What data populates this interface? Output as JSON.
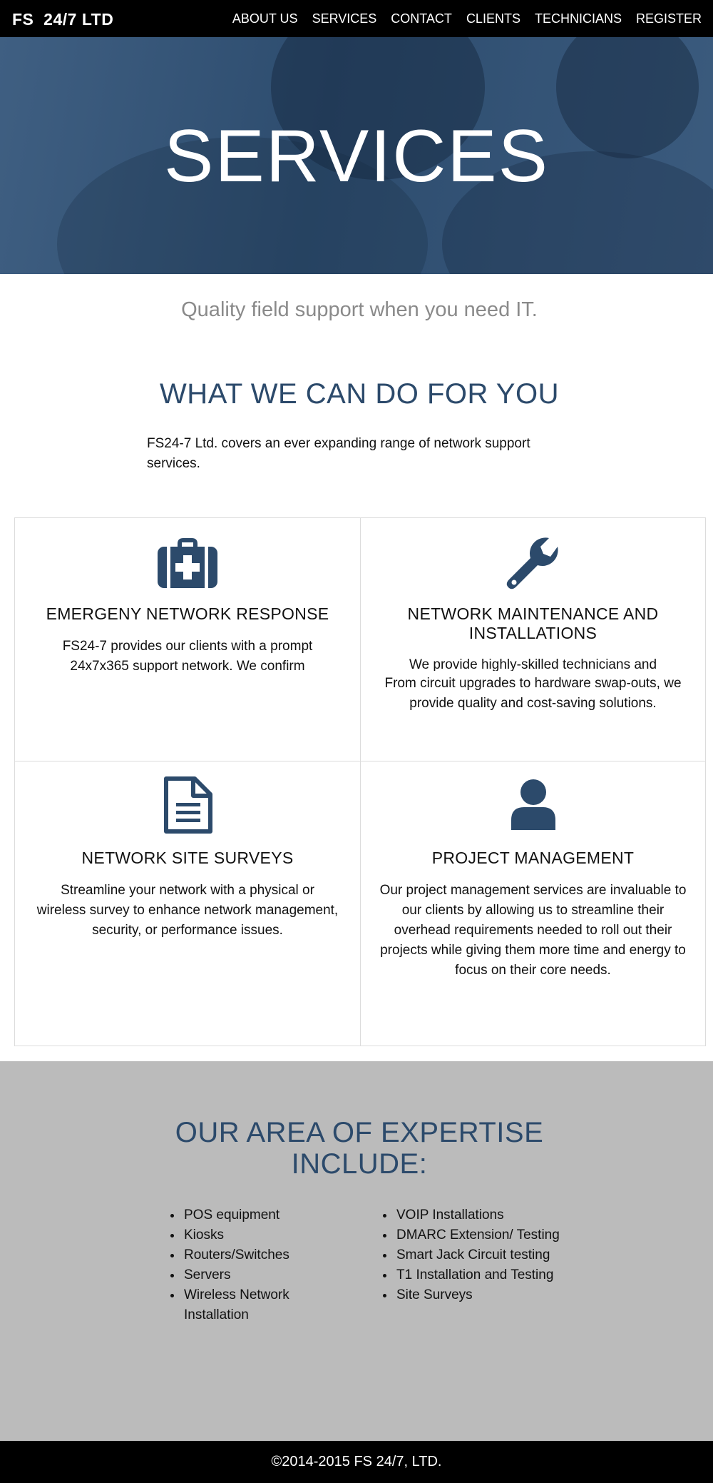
{
  "nav": {
    "brand": "FS  24/7 LTD",
    "links": [
      "ABOUT US",
      "SERVICES",
      "CONTACT",
      "CLIENTS",
      "TECHNICIANS",
      "REGISTER"
    ]
  },
  "hero": {
    "title": "SERVICES"
  },
  "intro": {
    "tagline": "Quality field support when you need IT.",
    "heading": "WHAT WE CAN DO FOR YOU",
    "text": "FS24-7 Ltd. covers an ever expanding range of network support services."
  },
  "services": [
    {
      "icon": "medical-kit-icon",
      "title": "EMERGENY NETWORK RESPONSE",
      "text": "FS24-7 provides our clients with a prompt 24x7x365 support network. We confirm"
    },
    {
      "icon": "wrench-icon",
      "title": "NETWORK MAINTENANCE AND INSTALLATIONS",
      "text_line1": "We provide highly-skilled technicians and",
      "text_line2": "From circuit upgrades to hardware swap-outs, we provide quality and cost-saving solutions."
    },
    {
      "icon": "document-icon",
      "title": "NETWORK SITE SURVEYS",
      "text": "Streamline your network with a physical or wireless survey to enhance network management, security, or performance issues."
    },
    {
      "icon": "user-icon",
      "title": "PROJECT MANAGEMENT",
      "text": "Our project management services are invaluable to our clients by allowing us to streamline their overhead requirements needed to roll out their projects while giving them more time and energy to focus on their core needs."
    }
  ],
  "expertise": {
    "heading": "OUR AREA OF EXPERTISE INCLUDE:",
    "left": [
      "POS equipment",
      "Kiosks",
      "Routers/Switches",
      "Servers",
      "Wireless Network Installation"
    ],
    "right": [
      "VOIP Installations",
      "DMARC Extension/ Testing",
      "Smart Jack Circuit testing",
      "T1 Installation and Testing",
      "Site Surveys"
    ]
  },
  "footer": {
    "text": "©2014-2015 FS 24/7, LTD."
  },
  "colors": {
    "accent": "#2c4a6b",
    "nav_bg": "#000000",
    "expertise_bg": "#bbbbbb",
    "muted_text": "#8a8a8a"
  }
}
